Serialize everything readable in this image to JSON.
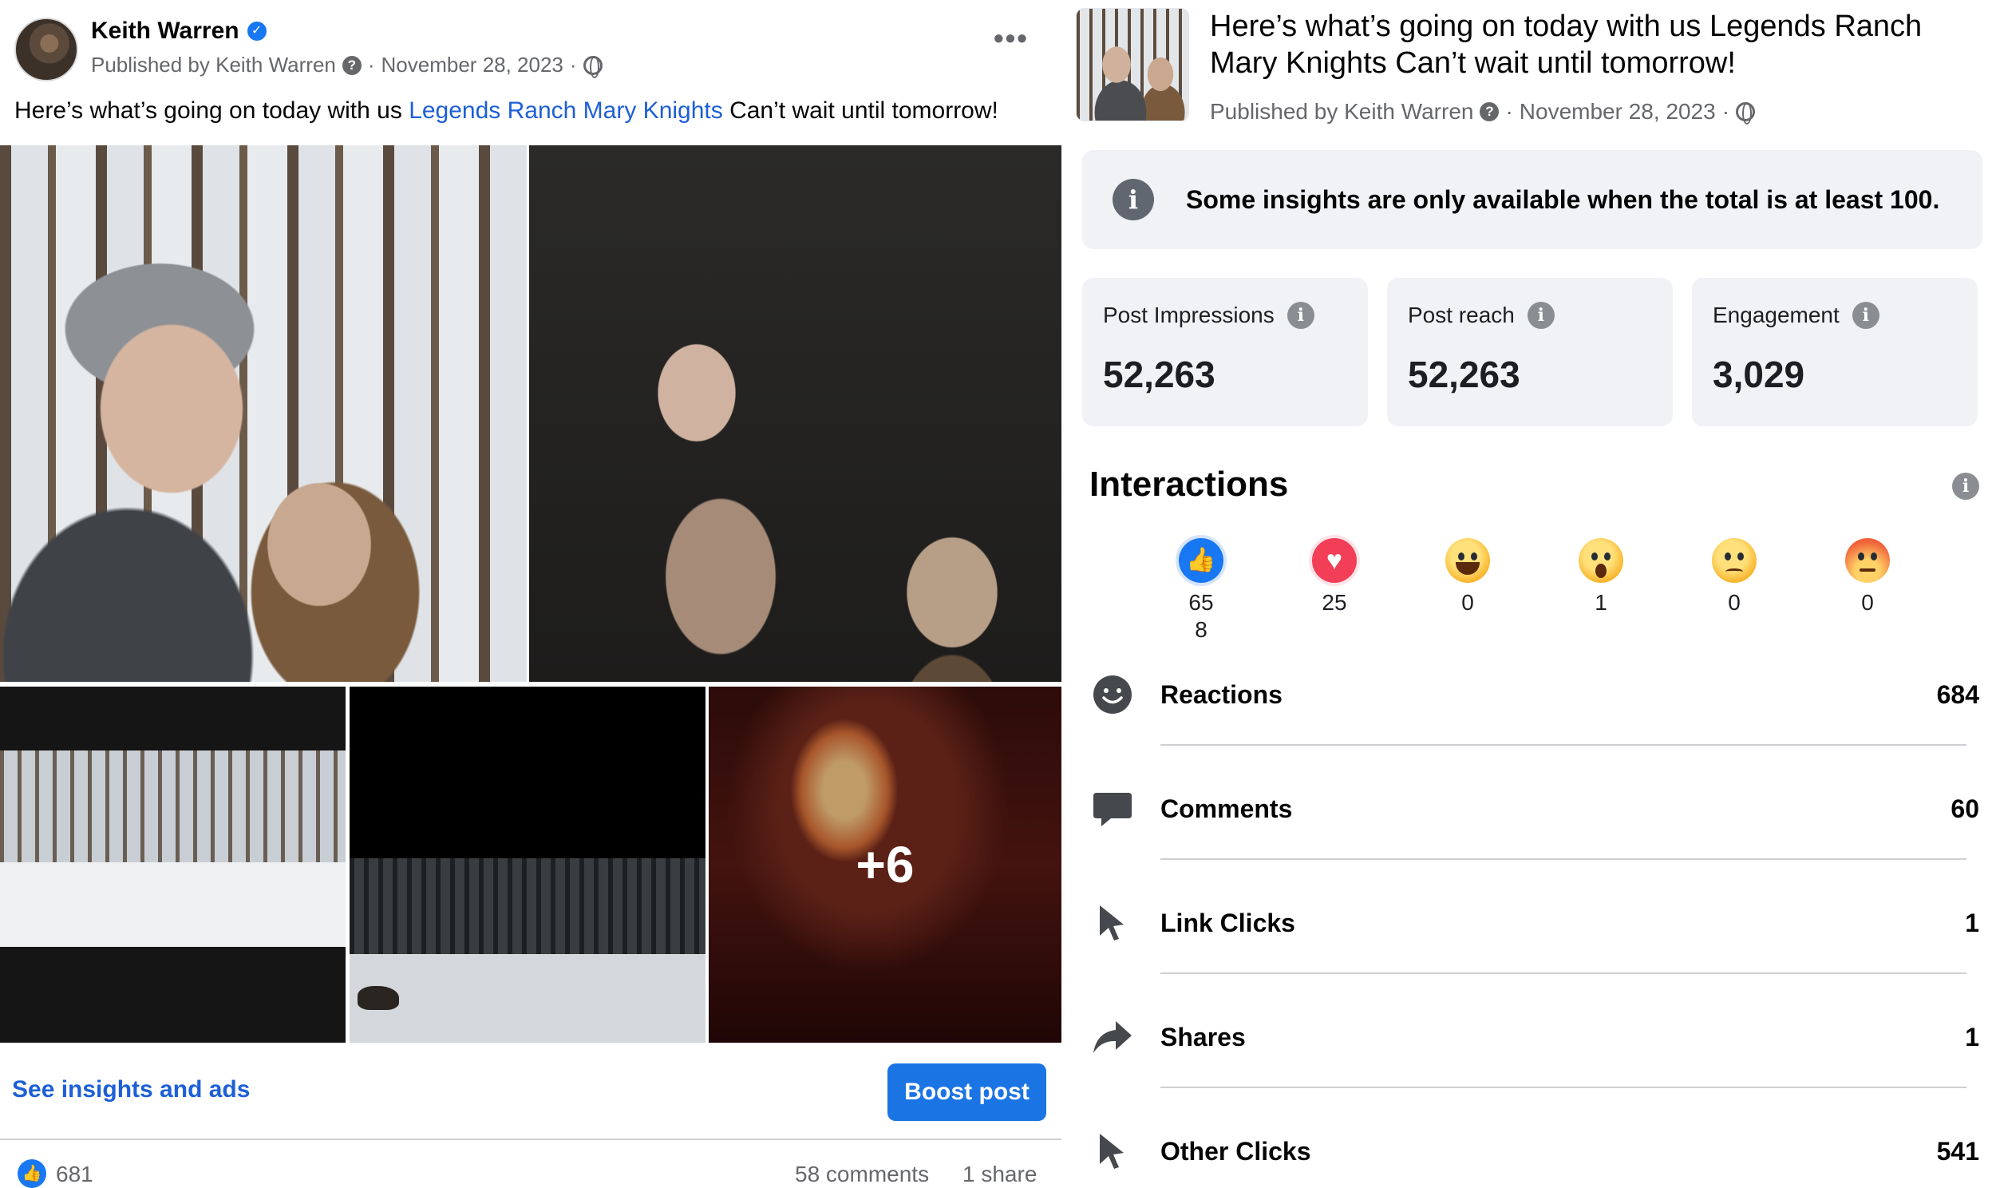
{
  "post": {
    "author": "Keith Warren",
    "published_by": "Published by Keith Warren",
    "date": "November 28, 2023",
    "separator_dot": "·",
    "caption_before": "Here’s what’s going on today with us ",
    "caption_link": "Legends Ranch Mary Knights",
    "caption_after": " Can’t wait until tomorrow!",
    "more_photos": "+6",
    "see_insights": "See insights and ads",
    "boost": "Boost post",
    "likes": "681",
    "comments": "58 comments",
    "shares": "1 share",
    "menu_icon": "more-options-icon"
  },
  "insights": {
    "title": "Here’s what’s going on today with us Legends Ranch Mary Knights Can’t wait until tomorrow!",
    "published_by": "Published by Keith Warren",
    "date": "November 28, 2023",
    "notice": "Some insights are only available when the total is at least 100.",
    "stats": [
      {
        "label": "Post Impressions",
        "value": "52,263"
      },
      {
        "label": "Post reach",
        "value": "52,263"
      },
      {
        "label": "Engagement",
        "value": "3,029"
      }
    ],
    "interactions_title": "Interactions",
    "reactions": [
      {
        "icon": "like-reaction-icon",
        "count": "65\n8"
      },
      {
        "icon": "love-reaction-icon",
        "count": "25"
      },
      {
        "icon": "haha-reaction-icon",
        "count": "0"
      },
      {
        "icon": "wow-reaction-icon",
        "count": "1"
      },
      {
        "icon": "sad-reaction-icon",
        "count": "0"
      },
      {
        "icon": "angry-reaction-icon",
        "count": "0"
      }
    ],
    "metrics": [
      {
        "icon": "smiley-icon",
        "label": "Reactions",
        "value": "684"
      },
      {
        "icon": "comment-bubble-icon",
        "label": "Comments",
        "value": "60"
      },
      {
        "icon": "cursor-icon",
        "label": "Link Clicks",
        "value": "1"
      },
      {
        "icon": "share-arrow-icon",
        "label": "Shares",
        "value": "1"
      },
      {
        "icon": "cursor-icon",
        "label": "Other Clicks",
        "value": "541"
      }
    ]
  },
  "colors": {
    "brand_blue": "#1877f2",
    "link_blue": "#1d5fd6",
    "secondary_text": "#65676b",
    "card_bg": "#f0f2f5"
  }
}
